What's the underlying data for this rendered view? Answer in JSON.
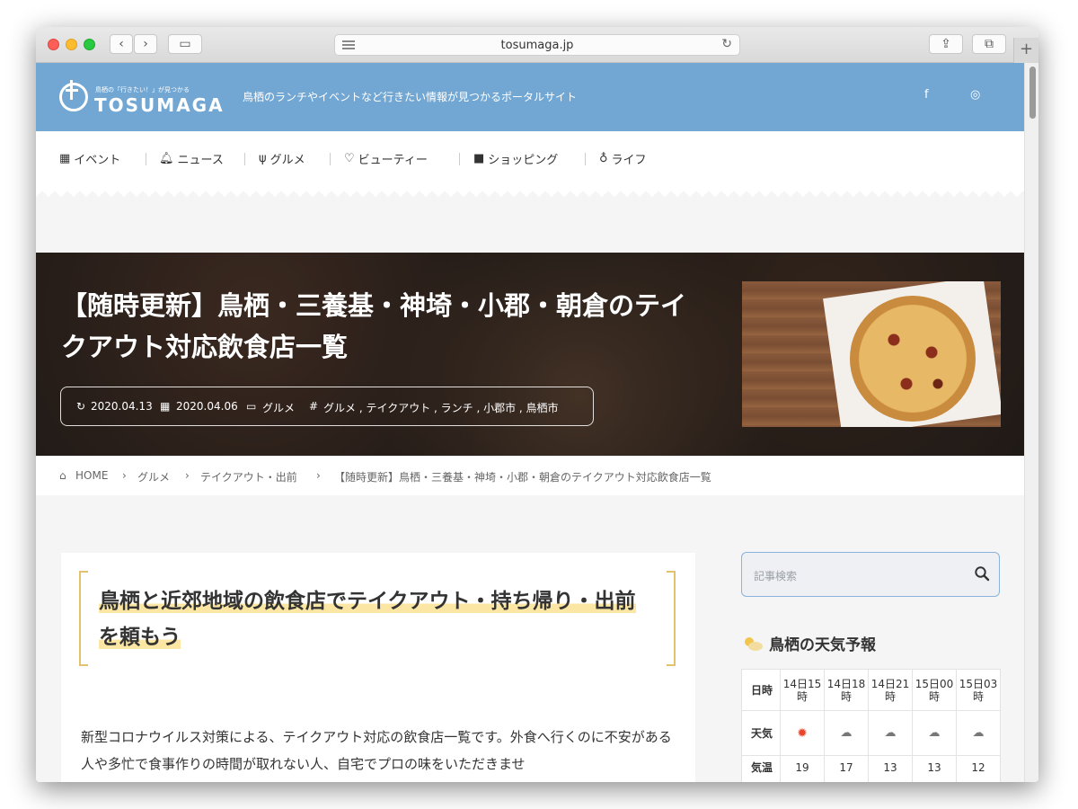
{
  "browser": {
    "url": "tosumaga.jp"
  },
  "site": {
    "logo_tagline": "鳥栖の「行きたい！」が見つかる",
    "logo_text": "TOSUMAGA",
    "tagline": "鳥栖のランチやイベントなど行きたい情報が見つかるポータルサイト",
    "social": [
      "f",
      "◎"
    ]
  },
  "nav": {
    "items": [
      {
        "icon": "calendar-icon",
        "label": "イベント"
      },
      {
        "icon": "bell-icon",
        "label": "ニュース"
      },
      {
        "icon": "fork-icon",
        "label": "グルメ"
      },
      {
        "icon": "heart-icon",
        "label": "ビューティー"
      },
      {
        "icon": "bag-icon",
        "label": "ショッピング"
      },
      {
        "icon": "bulb-icon",
        "label": "ライフ"
      }
    ]
  },
  "hero": {
    "title": "【随時更新】鳥栖・三養基・神埼・小郡・朝倉のテイクアウト対応飲食店一覧",
    "updated": "2020.04.13",
    "published": "2020.04.06",
    "category": "グルメ",
    "tags": "グルメ , テイクアウト , ランチ , 小郡市 , 鳥栖市"
  },
  "breadcrumb": [
    "HOME",
    "グルメ",
    "テイクアウト・出前",
    "【随時更新】鳥栖・三養基・神埼・小郡・朝倉のテイクアウト対応飲食店一覧"
  ],
  "article": {
    "heading": "鳥栖と近郊地域の飲食店でテイクアウト・持ち帰り・出前を頼もう",
    "paragraph": "新型コロナウイルス対策による、テイクアウト対応の飲食店一覧です。外食へ行くのに不安がある人や多忙で食事作りの時間が取れない人、自宅でプロの味をいただきませ"
  },
  "sidebar": {
    "search_placeholder": "記事検索",
    "weather_title": "鳥栖の天気予報",
    "weather": {
      "row_labels": [
        "日時",
        "天気",
        "気温"
      ],
      "times": [
        "14日15時",
        "14日18時",
        "14日21時",
        "15日00時",
        "15日03時"
      ],
      "conditions": [
        "sunny",
        "cloudy",
        "cloudy",
        "cloudy",
        "cloudy"
      ],
      "temps": [
        "19",
        "17",
        "13",
        "13",
        "12"
      ]
    }
  }
}
